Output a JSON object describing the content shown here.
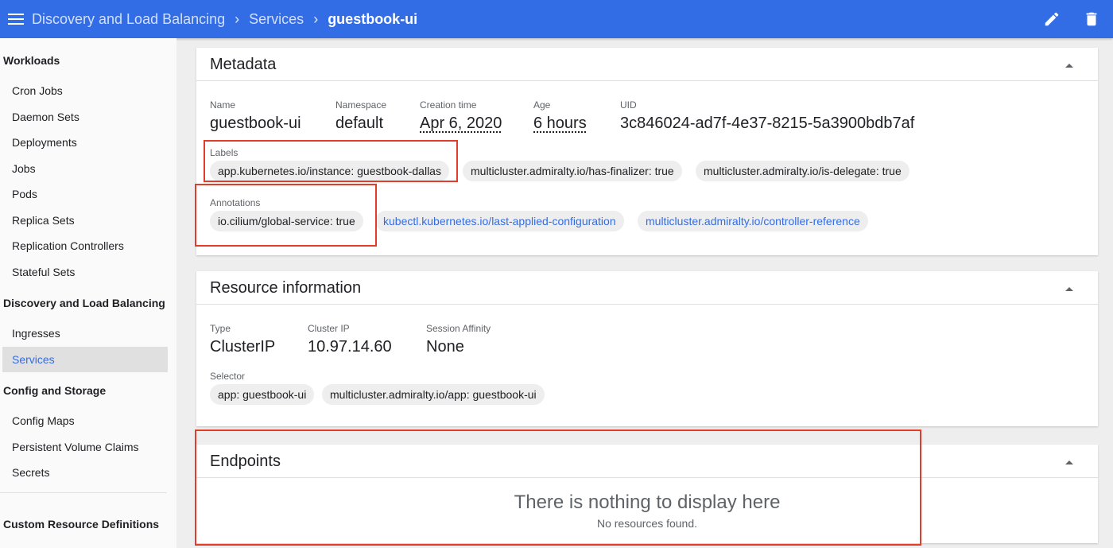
{
  "header": {
    "breadcrumbs": [
      "Discovery and Load Balancing",
      "Services",
      "guestbook-ui"
    ],
    "menu_icon": "menu-icon",
    "actions": [
      "edit-icon",
      "delete-icon"
    ],
    "bar_color": "#326de6"
  },
  "sidebar": {
    "groups": {
      "workloads": "Workloads",
      "discovery": "Discovery and Load Balancing",
      "config": "Config and Storage",
      "crd": "Custom Resource Definitions"
    },
    "items": {
      "cron_jobs": "Cron Jobs",
      "daemon_sets": "Daemon Sets",
      "deployments": "Deployments",
      "jobs": "Jobs",
      "pods": "Pods",
      "replica_sets": "Replica Sets",
      "replication_controllers": "Replication Controllers",
      "stateful_sets": "Stateful Sets",
      "ingresses": "Ingresses",
      "services": "Services",
      "config_maps": "Config Maps",
      "pvcs": "Persistent Volume Claims",
      "secrets": "Secrets"
    },
    "active_item": "Services"
  },
  "metadata": {
    "title": "Metadata",
    "fields": {
      "name": {
        "label": "Name",
        "value": "guestbook-ui"
      },
      "namespace": {
        "label": "Namespace",
        "value": "default"
      },
      "creation": {
        "label": "Creation time",
        "value": "Apr 6, 2020"
      },
      "age": {
        "label": "Age",
        "value": "6 hours"
      },
      "uid": {
        "label": "UID",
        "value": "3c846024-ad7f-4e37-8215-5a3900bdb7af"
      }
    },
    "labels_title": "Labels",
    "labels": [
      "app.kubernetes.io/instance: guestbook-dallas",
      "multicluster.admiralty.io/has-finalizer: true",
      "multicluster.admiralty.io/is-delegate: true"
    ],
    "annotations_title": "Annotations",
    "annotations": [
      "io.cilium/global-service: true",
      "kubectl.kubernetes.io/last-applied-configuration",
      "multicluster.admiralty.io/controller-reference"
    ]
  },
  "resource": {
    "title": "Resource information",
    "fields": {
      "type": {
        "label": "Type",
        "value": "ClusterIP"
      },
      "cluster_ip": {
        "label": "Cluster IP",
        "value": "10.97.14.60"
      },
      "affinity": {
        "label": "Session Affinity",
        "value": "None"
      }
    },
    "selector_title": "Selector",
    "selector": [
      "app: guestbook-ui",
      "multicluster.admiralty.io/app: guestbook-ui"
    ]
  },
  "endpoints": {
    "title": "Endpoints",
    "empty_title": "There is nothing to display here",
    "empty_sub": "No resources found."
  },
  "colors": {
    "accent": "#326de6",
    "highlight": "#e23c2a"
  }
}
